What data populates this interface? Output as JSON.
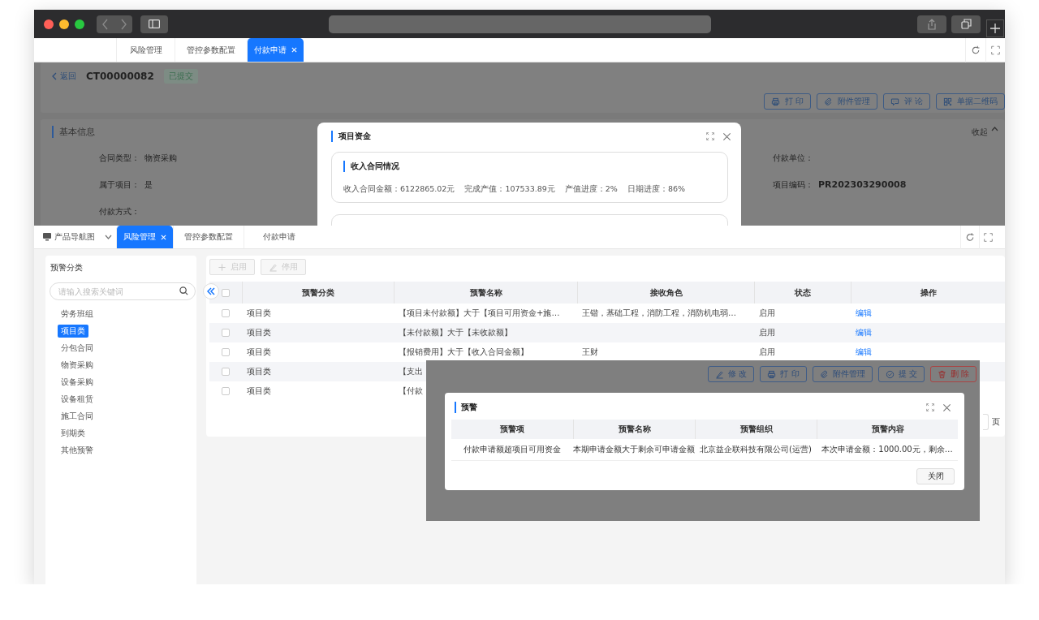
{
  "top_page": {
    "tabs": [
      {
        "label": "风险管理",
        "selected": false
      },
      {
        "label": "管控参数配置",
        "selected": false
      },
      {
        "label": "付款申请",
        "selected": true
      }
    ],
    "back": "返回",
    "doc_no": "CT00000082",
    "status": "已提交",
    "actions": [
      {
        "label": "打 印",
        "kind": "print"
      },
      {
        "label": "附件管理",
        "kind": "attach"
      },
      {
        "label": "评 论",
        "kind": "comment"
      },
      {
        "label": "单据二维码",
        "kind": "qr"
      }
    ],
    "section_title": "基本信息",
    "collapse": "收起",
    "fields_left": [
      {
        "label": "合同类型：",
        "value": "物资采购"
      },
      {
        "label": "属于项目：",
        "value": "是"
      },
      {
        "label": "付款方式："
      }
    ],
    "fields_right": [
      {
        "label": "付款单位："
      },
      {
        "label": "项目编码：",
        "value": "PR202303290008"
      }
    ],
    "modal": {
      "title": "项目资金",
      "card_title": "收入合同情况",
      "stats": [
        "收入合同金额：6122865.02元",
        "完成产值：107533.89元",
        "产值进度：2%",
        "日期进度：86%"
      ]
    }
  },
  "bottom_page": {
    "nav": "产品导航图",
    "tabs": [
      {
        "label": "风险管理",
        "selected": true
      },
      {
        "label": "管控参数配置",
        "selected": false
      },
      {
        "label": "付款申请",
        "selected": false
      }
    ],
    "sidebar": {
      "title": "预警分类",
      "search_placeholder": "请输入搜索关键词",
      "items": [
        {
          "label": "劳务班组",
          "selected": false
        },
        {
          "label": "项目类",
          "selected": true
        },
        {
          "label": "分包合同",
          "selected": false
        },
        {
          "label": "物资采购",
          "selected": false
        },
        {
          "label": "设备采购",
          "selected": false
        },
        {
          "label": "设备租赁",
          "selected": false
        },
        {
          "label": "施工合同",
          "selected": false
        },
        {
          "label": "到期类",
          "selected": false
        },
        {
          "label": "其他预警",
          "selected": false
        }
      ]
    },
    "toolbar": [
      {
        "label": "启用",
        "kind": "add",
        "disabled": true
      },
      {
        "label": "停用",
        "kind": "edit",
        "disabled": true
      }
    ],
    "table": {
      "header_checked": false,
      "columns": [
        "预警分类",
        "预警名称",
        "接收角色",
        "状态",
        "操作"
      ],
      "rows": [
        {
          "checked": false,
          "category": "项目类",
          "name": "【项目未付款额】大于【项目可用资金+施…",
          "roles": "王锴，基础工程，消防工程，消防机电弱…",
          "status": "启用",
          "action": "编辑"
        },
        {
          "checked": false,
          "category": "项目类",
          "name": "【未付款额】大于【未收款额】",
          "status": "启用",
          "action": "编辑"
        },
        {
          "checked": false,
          "category": "项目类",
          "name": "【报销费用】大于【收入合同金额】",
          "roles": "王财",
          "status": "启用",
          "action": "编辑"
        },
        {
          "checked": false,
          "category": "项目类",
          "name": "【支出"
        },
        {
          "checked": false,
          "category": "项目类",
          "name": "【付款"
        }
      ]
    },
    "pager_suffix": "页"
  },
  "overlay": {
    "buttons": [
      {
        "label": "修 改",
        "kind": "edit"
      },
      {
        "label": "打 印",
        "kind": "print"
      },
      {
        "label": "附件管理",
        "kind": "attach"
      },
      {
        "label": "提 交",
        "kind": "submit"
      },
      {
        "label": "删 除",
        "kind": "delete"
      }
    ],
    "modal": {
      "title": "预警",
      "columns": [
        "预警项",
        "预警名称",
        "预警组织",
        "预警内容"
      ],
      "rows": [
        [
          "付款申请额超项目可用资金",
          "本期申请金额大于剩余可申请金额",
          "北京益企联科技有限公司(运营)",
          "本次申请金额：1000.00元，剩余…"
        ]
      ],
      "close": "关闭"
    }
  }
}
